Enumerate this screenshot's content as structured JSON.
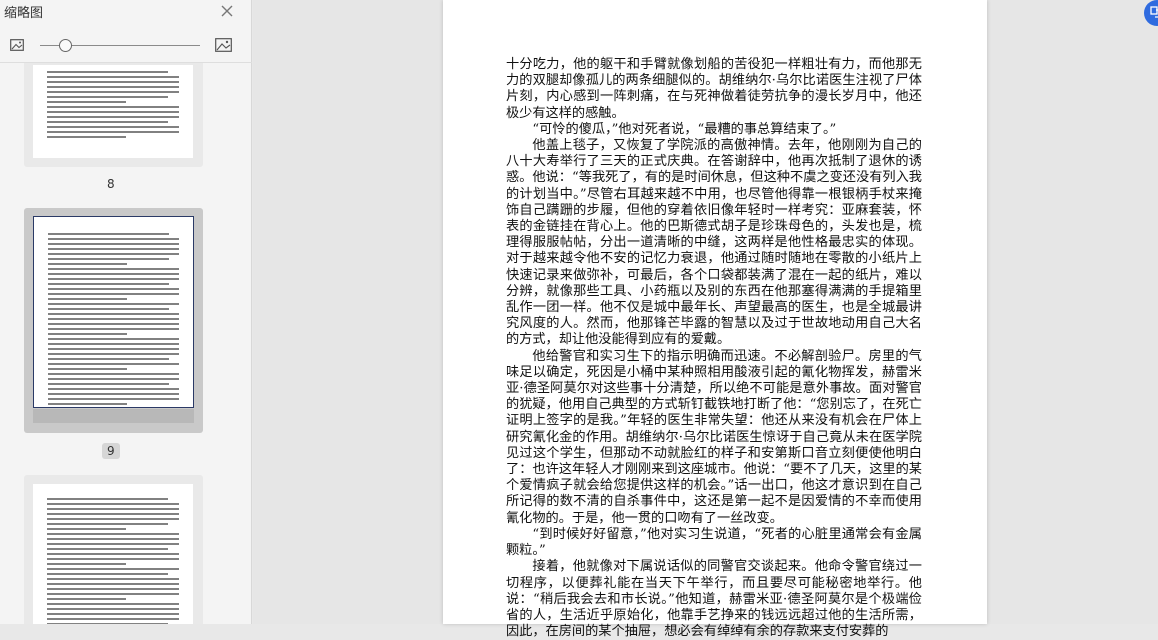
{
  "sidebar": {
    "title": "缩略图",
    "close_icon": "close-icon",
    "small_view_icon": "image-small-icon",
    "large_view_icon": "image-large-icon",
    "thumbnail_size": 0.2,
    "thumbnails": [
      {
        "label": "8",
        "selected": false
      },
      {
        "label": "9",
        "selected": true
      },
      {
        "label": "",
        "selected": false
      }
    ]
  },
  "document": {
    "paragraphs": [
      {
        "indent": false,
        "text": "十分吃力，他的躯干和手臂就像划船的苦役犯一样粗壮有力，而他那无力的双腿却像孤儿的两条细腿似的。胡维纳尔·乌尔比诺医生注视了尸体片刻，内心感到一阵刺痛，在与死神做着徒劳抗争的漫长岁月中，他还极少有这样的感触。"
      },
      {
        "indent": true,
        "text": "“可怜的傻瓜，”他对死者说，“最糟的事总算结束了。”"
      },
      {
        "indent": true,
        "text": "他盖上毯子，又恢复了学院派的高傲神情。去年，他刚刚为自己的八十大寿举行了三天的正式庆典。在答谢辞中，他再次抵制了退休的诱惑。他说：“等我死了，有的是时间休息，但这种不虞之变还没有列入我的计划当中。”尽管右耳越来越不中用，也尽管他得靠一根银柄手杖来掩饰自己蹒跚的步履，但他的穿着依旧像年轻时一样考究：亚麻套装，怀表的金链挂在背心上。他的巴斯德式胡子是珍珠母色的，头发也是，梳理得服服帖帖，分出一道清晰的中缝，这两样是他性格最忠实的体现。对于越来越令他不安的记忆力衰退，他通过随时随地在零散的小纸片上快速记录来做弥补，可最后，各个口袋都装满了混在一起的纸片，难以分辨，就像那些工具、小药瓶以及别的东西在他那塞得满满的手提箱里乱作一团一样。他不仅是城中最年长、声望最高的医生，也是全城最讲究风度的人。然而，他那锋芒毕露的智慧以及过于世故地动用自己大名的方式，却让他没能得到应有的爱戴。"
      },
      {
        "indent": true,
        "text": "他给警官和实习生下的指示明确而迅速。不必解剖验尸。房里的气味足以确定，死因是小桶中某种照相用酸液引起的氰化物挥发，赫雷米亚·德圣阿莫尔对这些事十分清楚，所以绝不可能是意外事故。面对警官的犹疑，他用自己典型的方式斩钉截铁地打断了他：“您别忘了，在死亡证明上签字的是我。”年轻的医生非常失望：他还从来没有机会在尸体上研究氰化金的作用。胡维纳尔·乌尔比诺医生惊讶于自己竟从未在医学院见过这个学生，但那动不动就脸红的样子和安第斯口音立刻便使他明白了：也许这年轻人才刚刚来到这座城市。他说：“要不了几天，这里的某个爱情疯子就会给您提供这样的机会。”话一出口，他这才意识到在自己所记得的数不清的自杀事件中，这还是第一起不是因爱情的不幸而使用氰化物的。于是，他一贯的口吻有了一丝改变。"
      },
      {
        "indent": true,
        "text": "“到时候好好留意，”他对实习生说道，“死者的心脏里通常会有金属颗粒。”"
      },
      {
        "indent": true,
        "text": "接着，他就像对下属说话似的同警官交谈起来。他命令警官绕过一切程序，以便葬礼能在当天下午举行，而且要尽可能秘密地举行。他说：“稍后我会去和市长说。”他知道，赫雷米亚·德圣阿莫尔是个极端俭省的人，生活近乎原始化，他靠手艺挣来的钱远远超过他的生活所需，因此，在房间的某个抽屉，想必会有绰绰有余的存款来支付安葬的"
      }
    ]
  },
  "floating_button": {
    "icon": "translate-icon",
    "color": "#2f6bdf"
  }
}
